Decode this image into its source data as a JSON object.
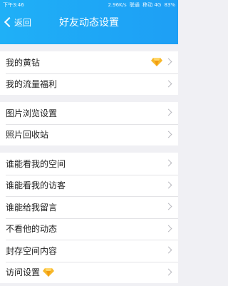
{
  "status_bar": {
    "time": "下午3:46",
    "speed": "2.96K/s",
    "carrier1": "联通",
    "carrier2": "移动 4G",
    "battery": "83%"
  },
  "nav": {
    "back_label": "返回",
    "title": "好友动态设置"
  },
  "groups": [
    {
      "items": [
        {
          "label": "我的黄钻"
        },
        {
          "label": "我的流量福利"
        }
      ]
    },
    {
      "items": [
        {
          "label": "图片浏览设置"
        },
        {
          "label": "照片回收站"
        }
      ]
    },
    {
      "items": [
        {
          "label": "谁能看我的空间"
        },
        {
          "label": "谁能看我的访客"
        },
        {
          "label": "谁能给我留言"
        },
        {
          "label": "不看他的动态"
        },
        {
          "label": "封存空间内容"
        },
        {
          "label": "访问设置"
        }
      ]
    }
  ],
  "icons": {
    "yellow_diamond": "yellow-diamond-icon",
    "chevron": "chevron-right-icon"
  },
  "colors": {
    "header": "#1fb0f7",
    "diamond": "#f7b82a"
  }
}
